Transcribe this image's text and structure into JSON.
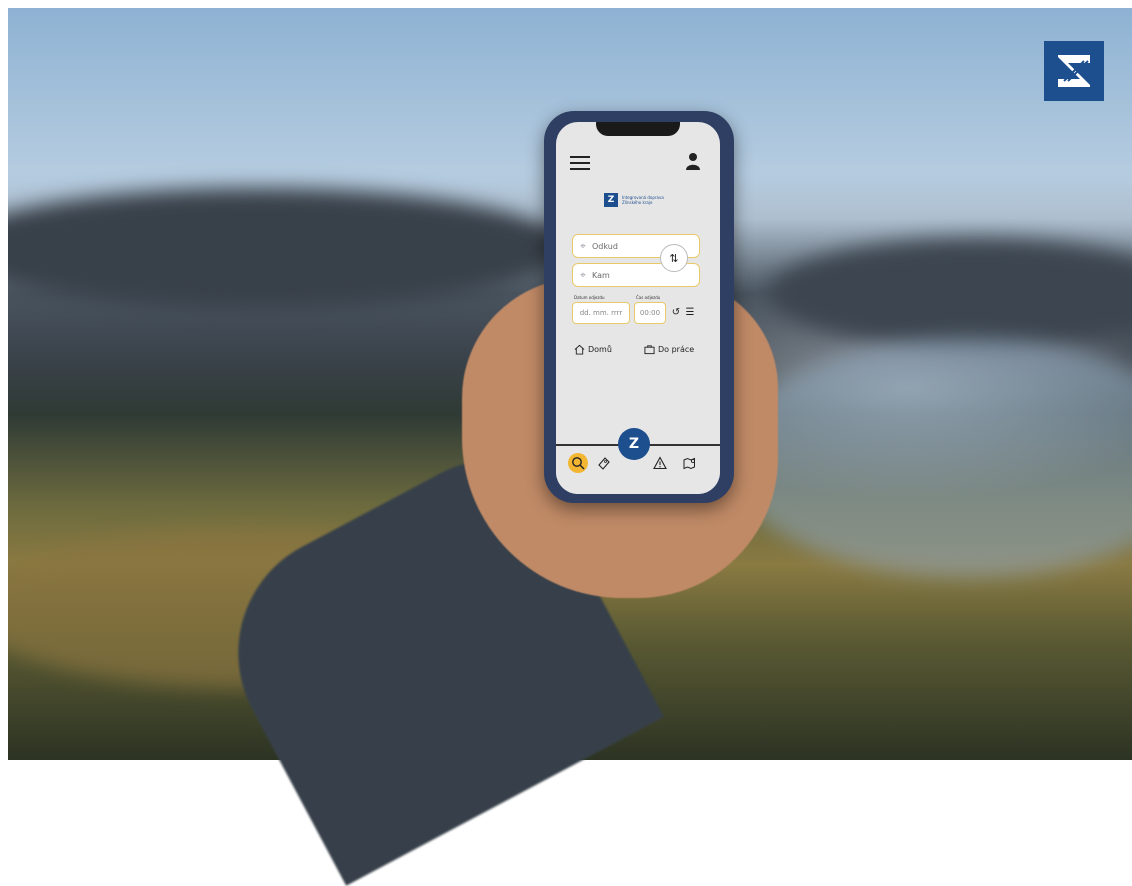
{
  "corner_logo": {
    "icon": "z-logo-icon",
    "color": "#1d4f8f"
  },
  "app": {
    "brand_line1": "Integrovaná doprava",
    "brand_line2": "Zlínského kraje",
    "from_placeholder": "Odkud",
    "to_placeholder": "Kam",
    "date_label": "Datum odjezdu",
    "date_placeholder": "dd. mm. rrrr",
    "time_label": "Čas odjezdu",
    "time_value": "00:00",
    "shortcut_home": "Domů",
    "shortcut_work": "Do práce",
    "nav": [
      {
        "name": "search",
        "icon": "search-icon",
        "active": true
      },
      {
        "name": "tickets",
        "icon": "ticket-icon",
        "active": false
      },
      {
        "name": "home",
        "icon": "z-logo-icon",
        "active": false
      },
      {
        "name": "alerts",
        "icon": "warning-icon",
        "active": false
      },
      {
        "name": "map",
        "icon": "map-icon",
        "active": false
      }
    ],
    "accent_color": "#f3b632",
    "brand_color": "#1d4f8f"
  }
}
